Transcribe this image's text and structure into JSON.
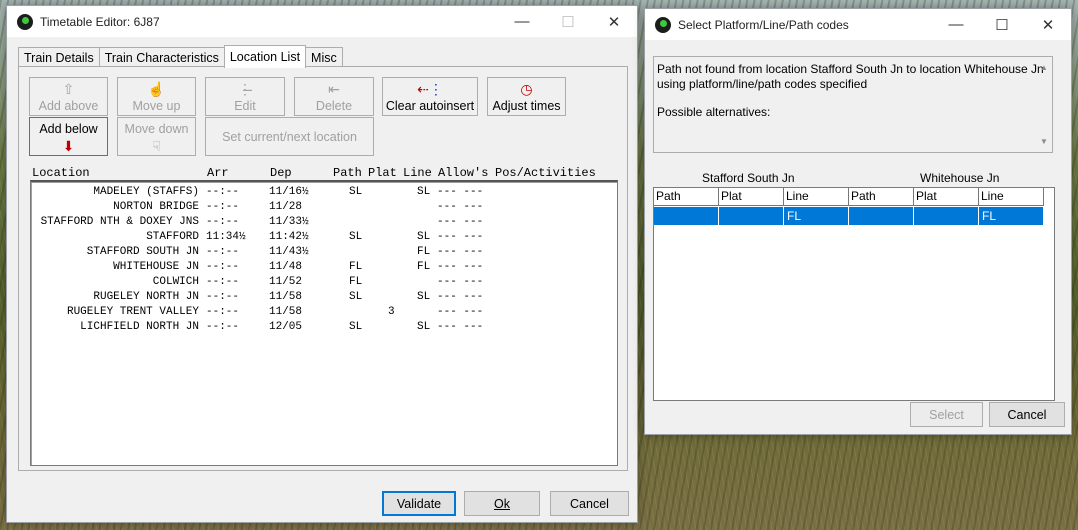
{
  "editor": {
    "title": "Timetable Editor: 6J87",
    "controls": {
      "minimize": "—",
      "maximize": "☐",
      "close": "✕"
    },
    "tabs": [
      "Train Details",
      "Train Characteristics",
      "Location List",
      "Misc"
    ],
    "active_tab": "Location List",
    "toolbar": {
      "add_above": "Add above",
      "move_up": "Move up",
      "edit": "Edit",
      "delete": "Delete",
      "clear_autoinsert": "Clear autoinsert",
      "adjust_times": "Adjust times",
      "add_below": "Add below",
      "move_down": "Move down",
      "set_current_next": "Set current/next location"
    },
    "grid": {
      "headers": [
        "Location",
        "Arr",
        "Dep",
        "Path",
        "Plat",
        "Line",
        "Allow's",
        "Pos/Activities"
      ],
      "rows": [
        {
          "location": "MADELEY (STAFFS)",
          "arr": "--:--",
          "dep": "11/16½",
          "path": "SL",
          "plat": "",
          "line": "SL",
          "allow": "--- ---"
        },
        {
          "location": "NORTON BRIDGE",
          "arr": "--:--",
          "dep": "11/28",
          "path": "",
          "plat": "",
          "line": "",
          "allow": "--- ---"
        },
        {
          "location": "STAFFORD NTH & DOXEY JNS",
          "arr": "--:--",
          "dep": "11/33½",
          "path": "",
          "plat": "",
          "line": "",
          "allow": "--- ---"
        },
        {
          "location": "STAFFORD",
          "arr": "11:34½",
          "dep": "11:42½",
          "path": "SL",
          "plat": "",
          "line": "SL",
          "allow": "--- ---"
        },
        {
          "location": "STAFFORD SOUTH JN",
          "arr": "--:--",
          "dep": "11/43½",
          "path": "",
          "plat": "",
          "line": "FL",
          "allow": "--- ---"
        },
        {
          "location": "WHITEHOUSE JN",
          "arr": "--:--",
          "dep": "11/48",
          "path": "FL",
          "plat": "",
          "line": "FL",
          "allow": "--- ---"
        },
        {
          "location": "COLWICH",
          "arr": "--:--",
          "dep": "11/52",
          "path": "FL",
          "plat": "",
          "line": "",
          "allow": "--- ---"
        },
        {
          "location": "RUGELEY NORTH JN",
          "arr": "--:--",
          "dep": "11/58",
          "path": "SL",
          "plat": "",
          "line": "SL",
          "allow": "--- ---"
        },
        {
          "location": "RUGELEY TRENT VALLEY",
          "arr": "--:--",
          "dep": "11/58",
          "path": "",
          "plat": "3",
          "line": "",
          "allow": "--- ---"
        },
        {
          "location": "LICHFIELD NORTH JN",
          "arr": "--:--",
          "dep": "12/05",
          "path": "SL",
          "plat": "",
          "line": "SL",
          "allow": "--- ---"
        }
      ]
    },
    "buttons": {
      "validate": "Validate",
      "ok": "Ok",
      "cancel": "Cancel"
    }
  },
  "select_dialog": {
    "title": "Select Platform/Line/Path codes",
    "controls": {
      "minimize": "—",
      "maximize": "☐",
      "close": "✕"
    },
    "message_line1": "Path not found from location Stafford South Jn to location Whitehouse Jn",
    "message_line2": "using platform/line/path codes specified",
    "message_line3": "Possible alternatives:",
    "from_location": "Stafford South Jn",
    "to_location": "Whitehouse Jn",
    "columns": [
      "Path",
      "Plat",
      "Line",
      "Path",
      "Plat",
      "Line"
    ],
    "selected_row": [
      "",
      "",
      "FL",
      "",
      "",
      "FL"
    ],
    "buttons": {
      "select": "Select",
      "cancel": "Cancel"
    }
  },
  "colors": {
    "selection": "#0078d7",
    "window_bg": "#f0f0f0",
    "red_arrow": "#c00000"
  }
}
